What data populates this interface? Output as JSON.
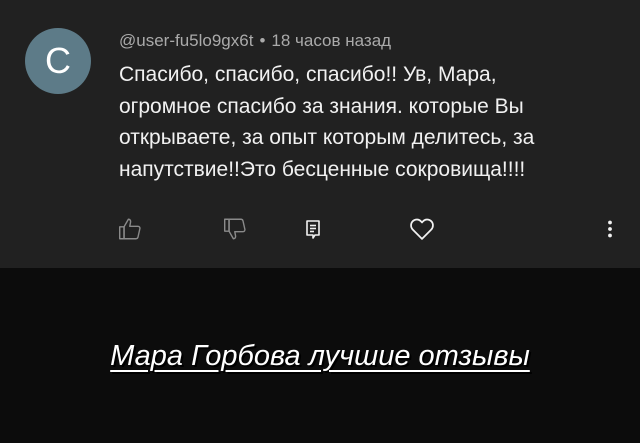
{
  "comment": {
    "avatar_letter": "C",
    "author": "@user-fu5lo9gx6t",
    "separator": "•",
    "timestamp": "18 часов назад",
    "text_lines": [
      "Спасибо, спасибо, спасибо!! Ув, Мара,",
      "огромное спасибо за знания. которые Вы",
      "открываете, за опыт которым делитесь, за",
      "напутствие!!Это бесценные сокровища!!!!"
    ],
    "actions": {
      "like_icon": "thumbs-up-icon",
      "dislike_icon": "thumbs-down-icon",
      "reply_icon": "reply-icon",
      "heart_icon": "heart-icon",
      "more_icon": "more-vertical-icon"
    }
  },
  "footer": {
    "title": "Мара Горбова лучшие отзывы"
  },
  "colors": {
    "card_background": "#212121",
    "page_background": "#0c0c0c",
    "avatar_background": "#5d7b88",
    "meta_text": "#aaaaaa",
    "body_text": "#f1f1f1",
    "icon_color": "#8a8a8a",
    "reply_icon_color": "#f1f1f1"
  }
}
